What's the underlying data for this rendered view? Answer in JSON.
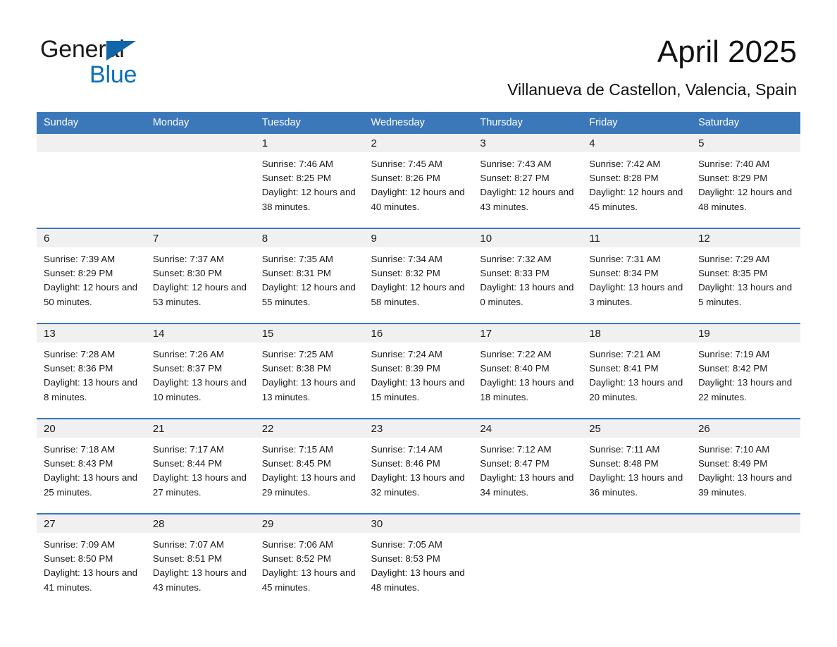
{
  "brand": {
    "name_part1": "General",
    "name_part2": "Blue",
    "triangle_icon": "triangle-icon",
    "accent_color": "#0a6ebd"
  },
  "header": {
    "title": "April 2025",
    "subtitle": "Villanueva de Castellon, Valencia, Spain"
  },
  "calendar": {
    "header_color": "#3b78ba",
    "daynum_band_color": "#f0f0f0",
    "weekday_headers": [
      "Sunday",
      "Monday",
      "Tuesday",
      "Wednesday",
      "Thursday",
      "Friday",
      "Saturday"
    ],
    "weeks": [
      [
        {
          "day": "",
          "sunrise": "",
          "sunset": "",
          "daylight": "",
          "empty": true
        },
        {
          "day": "",
          "sunrise": "",
          "sunset": "",
          "daylight": "",
          "empty": true
        },
        {
          "day": "1",
          "sunrise": "Sunrise: 7:46 AM",
          "sunset": "Sunset: 8:25 PM",
          "daylight": "Daylight: 12 hours and 38 minutes.",
          "empty": false
        },
        {
          "day": "2",
          "sunrise": "Sunrise: 7:45 AM",
          "sunset": "Sunset: 8:26 PM",
          "daylight": "Daylight: 12 hours and 40 minutes.",
          "empty": false
        },
        {
          "day": "3",
          "sunrise": "Sunrise: 7:43 AM",
          "sunset": "Sunset: 8:27 PM",
          "daylight": "Daylight: 12 hours and 43 minutes.",
          "empty": false
        },
        {
          "day": "4",
          "sunrise": "Sunrise: 7:42 AM",
          "sunset": "Sunset: 8:28 PM",
          "daylight": "Daylight: 12 hours and 45 minutes.",
          "empty": false
        },
        {
          "day": "5",
          "sunrise": "Sunrise: 7:40 AM",
          "sunset": "Sunset: 8:29 PM",
          "daylight": "Daylight: 12 hours and 48 minutes.",
          "empty": false
        }
      ],
      [
        {
          "day": "6",
          "sunrise": "Sunrise: 7:39 AM",
          "sunset": "Sunset: 8:29 PM",
          "daylight": "Daylight: 12 hours and 50 minutes.",
          "empty": false
        },
        {
          "day": "7",
          "sunrise": "Sunrise: 7:37 AM",
          "sunset": "Sunset: 8:30 PM",
          "daylight": "Daylight: 12 hours and 53 minutes.",
          "empty": false
        },
        {
          "day": "8",
          "sunrise": "Sunrise: 7:35 AM",
          "sunset": "Sunset: 8:31 PM",
          "daylight": "Daylight: 12 hours and 55 minutes.",
          "empty": false
        },
        {
          "day": "9",
          "sunrise": "Sunrise: 7:34 AM",
          "sunset": "Sunset: 8:32 PM",
          "daylight": "Daylight: 12 hours and 58 minutes.",
          "empty": false
        },
        {
          "day": "10",
          "sunrise": "Sunrise: 7:32 AM",
          "sunset": "Sunset: 8:33 PM",
          "daylight": "Daylight: 13 hours and 0 minutes.",
          "empty": false
        },
        {
          "day": "11",
          "sunrise": "Sunrise: 7:31 AM",
          "sunset": "Sunset: 8:34 PM",
          "daylight": "Daylight: 13 hours and 3 minutes.",
          "empty": false
        },
        {
          "day": "12",
          "sunrise": "Sunrise: 7:29 AM",
          "sunset": "Sunset: 8:35 PM",
          "daylight": "Daylight: 13 hours and 5 minutes.",
          "empty": false
        }
      ],
      [
        {
          "day": "13",
          "sunrise": "Sunrise: 7:28 AM",
          "sunset": "Sunset: 8:36 PM",
          "daylight": "Daylight: 13 hours and 8 minutes.",
          "empty": false
        },
        {
          "day": "14",
          "sunrise": "Sunrise: 7:26 AM",
          "sunset": "Sunset: 8:37 PM",
          "daylight": "Daylight: 13 hours and 10 minutes.",
          "empty": false
        },
        {
          "day": "15",
          "sunrise": "Sunrise: 7:25 AM",
          "sunset": "Sunset: 8:38 PM",
          "daylight": "Daylight: 13 hours and 13 minutes.",
          "empty": false
        },
        {
          "day": "16",
          "sunrise": "Sunrise: 7:24 AM",
          "sunset": "Sunset: 8:39 PM",
          "daylight": "Daylight: 13 hours and 15 minutes.",
          "empty": false
        },
        {
          "day": "17",
          "sunrise": "Sunrise: 7:22 AM",
          "sunset": "Sunset: 8:40 PM",
          "daylight": "Daylight: 13 hours and 18 minutes.",
          "empty": false
        },
        {
          "day": "18",
          "sunrise": "Sunrise: 7:21 AM",
          "sunset": "Sunset: 8:41 PM",
          "daylight": "Daylight: 13 hours and 20 minutes.",
          "empty": false
        },
        {
          "day": "19",
          "sunrise": "Sunrise: 7:19 AM",
          "sunset": "Sunset: 8:42 PM",
          "daylight": "Daylight: 13 hours and 22 minutes.",
          "empty": false
        }
      ],
      [
        {
          "day": "20",
          "sunrise": "Sunrise: 7:18 AM",
          "sunset": "Sunset: 8:43 PM",
          "daylight": "Daylight: 13 hours and 25 minutes.",
          "empty": false
        },
        {
          "day": "21",
          "sunrise": "Sunrise: 7:17 AM",
          "sunset": "Sunset: 8:44 PM",
          "daylight": "Daylight: 13 hours and 27 minutes.",
          "empty": false
        },
        {
          "day": "22",
          "sunrise": "Sunrise: 7:15 AM",
          "sunset": "Sunset: 8:45 PM",
          "daylight": "Daylight: 13 hours and 29 minutes.",
          "empty": false
        },
        {
          "day": "23",
          "sunrise": "Sunrise: 7:14 AM",
          "sunset": "Sunset: 8:46 PM",
          "daylight": "Daylight: 13 hours and 32 minutes.",
          "empty": false
        },
        {
          "day": "24",
          "sunrise": "Sunrise: 7:12 AM",
          "sunset": "Sunset: 8:47 PM",
          "daylight": "Daylight: 13 hours and 34 minutes.",
          "empty": false
        },
        {
          "day": "25",
          "sunrise": "Sunrise: 7:11 AM",
          "sunset": "Sunset: 8:48 PM",
          "daylight": "Daylight: 13 hours and 36 minutes.",
          "empty": false
        },
        {
          "day": "26",
          "sunrise": "Sunrise: 7:10 AM",
          "sunset": "Sunset: 8:49 PM",
          "daylight": "Daylight: 13 hours and 39 minutes.",
          "empty": false
        }
      ],
      [
        {
          "day": "27",
          "sunrise": "Sunrise: 7:09 AM",
          "sunset": "Sunset: 8:50 PM",
          "daylight": "Daylight: 13 hours and 41 minutes.",
          "empty": false
        },
        {
          "day": "28",
          "sunrise": "Sunrise: 7:07 AM",
          "sunset": "Sunset: 8:51 PM",
          "daylight": "Daylight: 13 hours and 43 minutes.",
          "empty": false
        },
        {
          "day": "29",
          "sunrise": "Sunrise: 7:06 AM",
          "sunset": "Sunset: 8:52 PM",
          "daylight": "Daylight: 13 hours and 45 minutes.",
          "empty": false
        },
        {
          "day": "30",
          "sunrise": "Sunrise: 7:05 AM",
          "sunset": "Sunset: 8:53 PM",
          "daylight": "Daylight: 13 hours and 48 minutes.",
          "empty": false
        },
        {
          "day": "",
          "sunrise": "",
          "sunset": "",
          "daylight": "",
          "empty": true
        },
        {
          "day": "",
          "sunrise": "",
          "sunset": "",
          "daylight": "",
          "empty": true
        },
        {
          "day": "",
          "sunrise": "",
          "sunset": "",
          "daylight": "",
          "empty": true
        }
      ]
    ]
  }
}
